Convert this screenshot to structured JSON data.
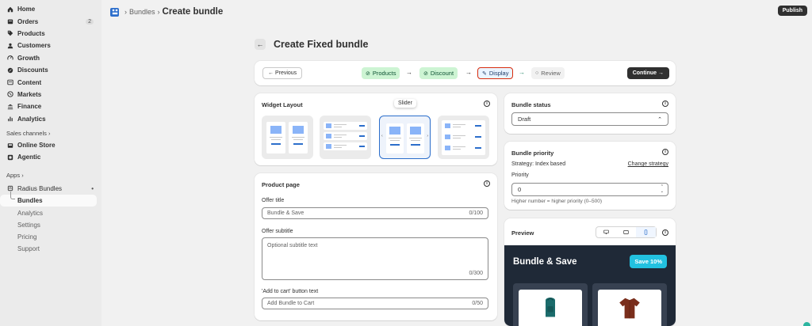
{
  "sidebar": {
    "items": [
      {
        "label": "Home",
        "icon": "home-icon"
      },
      {
        "label": "Orders",
        "icon": "orders-icon",
        "badge": "2"
      },
      {
        "label": "Products",
        "icon": "tag-icon"
      },
      {
        "label": "Customers",
        "icon": "person-icon"
      },
      {
        "label": "Growth",
        "icon": "gauge-icon"
      },
      {
        "label": "Discounts",
        "icon": "discount-icon"
      },
      {
        "label": "Content",
        "icon": "content-icon"
      },
      {
        "label": "Markets",
        "icon": "globe-icon"
      },
      {
        "label": "Finance",
        "icon": "bank-icon"
      },
      {
        "label": "Analytics",
        "icon": "chart-bars-icon"
      }
    ],
    "sales_channels_label": "Sales channels",
    "sales_channels": [
      {
        "label": "Online Store",
        "icon": "store-icon"
      },
      {
        "label": "Agentic",
        "icon": "agentic-icon"
      }
    ],
    "apps_label": "Apps",
    "app_name": "Radius Bundles",
    "app_subitems": [
      "Bundles",
      "Analytics",
      "Settings",
      "Pricing",
      "Support"
    ]
  },
  "topbar": {
    "breadcrumb_parent": "Bundles",
    "breadcrumb_current": "Create bundle",
    "publish_label": "Publish"
  },
  "page": {
    "title": "Create Fixed bundle"
  },
  "steps": {
    "previous_label": "← Previous",
    "items": [
      {
        "label": "Products",
        "state": "done"
      },
      {
        "label": "Discount",
        "state": "done"
      },
      {
        "label": "Display",
        "state": "current"
      },
      {
        "label": "Review",
        "state": "todo"
      }
    ],
    "continue_label": "Continue →"
  },
  "widget_layout": {
    "title": "Widget Layout",
    "tooltip": "Slider",
    "selected_index": 2
  },
  "product_page": {
    "title": "Product page",
    "offer_title_label": "Offer title",
    "offer_title_placeholder": "Bundle & Save",
    "offer_title_counter": "0/100",
    "offer_subtitle_label": "Offer subtitle",
    "offer_subtitle_placeholder": "Optional subtitle text",
    "offer_subtitle_counter": "0/300",
    "cart_label": "'Add to cart' button text",
    "cart_placeholder": "Add Bundle to Cart",
    "cart_counter": "0/50"
  },
  "bundle_status": {
    "title": "Bundle status",
    "value": "Draft"
  },
  "bundle_priority": {
    "title": "Bundle priority",
    "strategy": "Strategy: Index based",
    "change_link": "Change strategy",
    "priority_label": "Priority",
    "priority_value": "0",
    "help": "Higher number = higher priority (0–500)"
  },
  "preview": {
    "title": "Preview",
    "widget_title": "Bundle & Save",
    "badge": "Save 10%",
    "colors": {
      "background": "#1f2937",
      "badge": "#22c1e0"
    }
  }
}
